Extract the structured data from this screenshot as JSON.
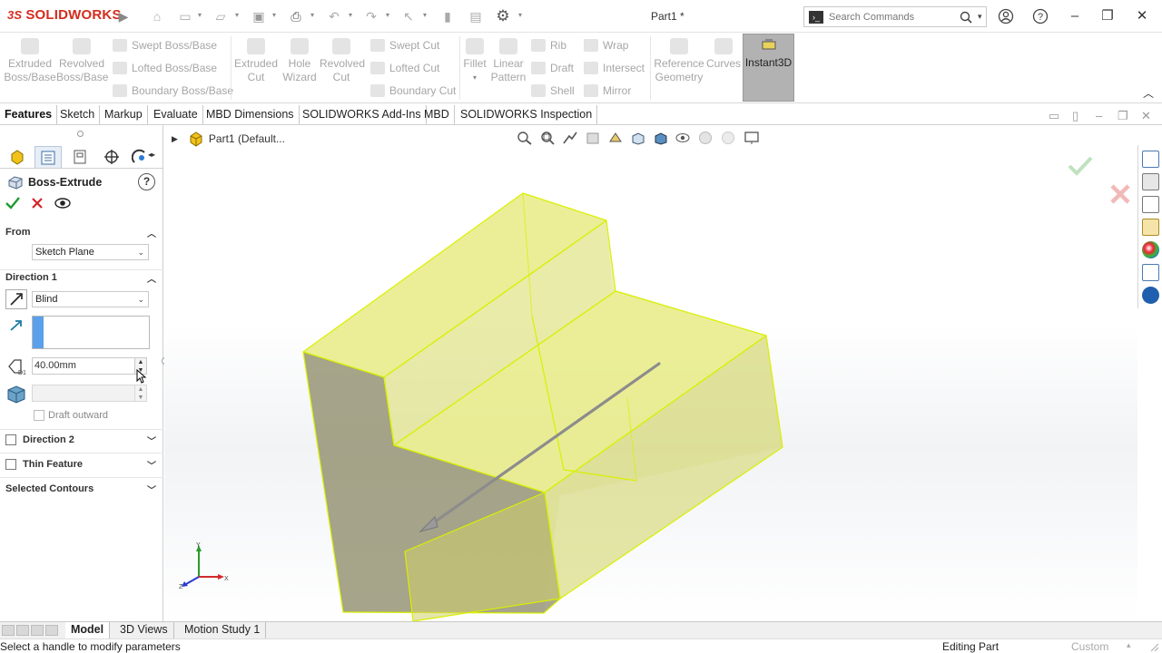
{
  "app": {
    "brand": "SOLIDWORKS",
    "brand_prefix": "3S",
    "document_title": "Part1 *"
  },
  "search": {
    "placeholder": "Search Commands"
  },
  "commands": {
    "extruded_boss": "Extruded Boss/Base",
    "revolved_boss": "Revolved Boss/Base",
    "swept_boss": "Swept Boss/Base",
    "lofted_boss": "Lofted Boss/Base",
    "boundary_boss": "Boundary Boss/Base",
    "extruded_cut": "Extruded Cut",
    "hole_wizard": "Hole Wizard",
    "revolved_cut": "Revolved Cut",
    "swept_cut": "Swept Cut",
    "lofted_cut": "Lofted Cut",
    "boundary_cut": "Boundary Cut",
    "fillet": "Fillet",
    "linear_pattern": "Linear Pattern",
    "rib": "Rib",
    "draft": "Draft",
    "shell": "Shell",
    "wrap": "Wrap",
    "intersect": "Intersect",
    "mirror": "Mirror",
    "reference_geometry": "Reference Geometry",
    "curves": "Curves",
    "instant3d": "Instant3D"
  },
  "tabs": [
    "Features",
    "Sketch",
    "Markup",
    "Evaluate",
    "MBD Dimensions",
    "SOLIDWORKS Add-Ins",
    "MBD",
    "SOLIDWORKS Inspection"
  ],
  "property_manager": {
    "title": "Boss-Extrude",
    "help": "?",
    "from": {
      "label": "From",
      "value": "Sketch Plane"
    },
    "direction1": {
      "label": "Direction 1",
      "end_condition": "Blind",
      "depth": "40.00mm",
      "draft_outward": "Draft outward"
    },
    "direction2": "Direction 2",
    "thin_feature": "Thin Feature",
    "selected_contours": "Selected Contours"
  },
  "graphics": {
    "tree_root": "Part1  (Default...",
    "triad": {
      "x": "X",
      "y": "Y",
      "z": "Z"
    },
    "body_color": "#e8ec7a",
    "edge_color": "#d9f000"
  },
  "bottom_tabs": [
    "Model",
    "3D Views",
    "Motion Study 1"
  ],
  "status": {
    "message": "Select a handle to modify parameters",
    "mode": "Editing Part",
    "units": "Custom"
  }
}
